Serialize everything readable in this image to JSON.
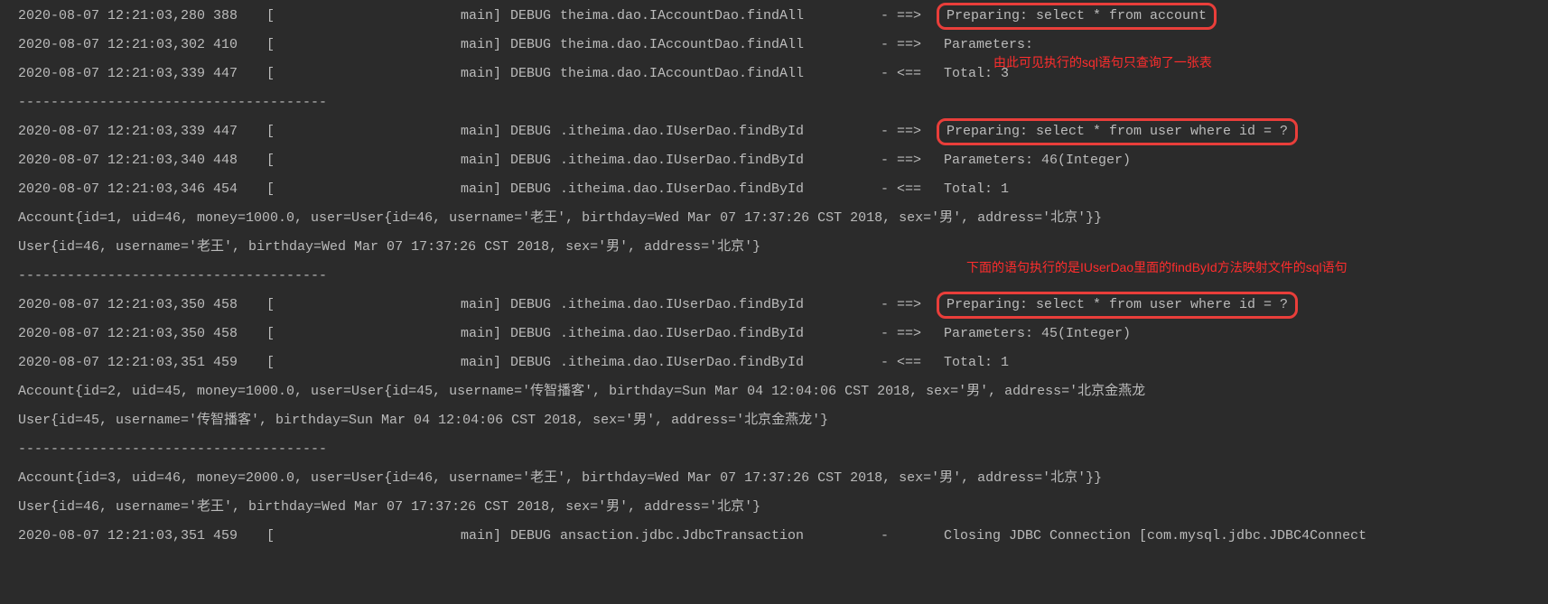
{
  "lines": [
    {
      "type": "log",
      "ts": "2020-08-07 12:21:03,280 388",
      "thread": "main]",
      "level": "DEBUG",
      "logger": "theima.dao.IAccountDao.findAll",
      "arrow": "- ==>",
      "msg": "Preparing: select * from account",
      "highlight": true
    },
    {
      "type": "log",
      "ts": "2020-08-07 12:21:03,302 410",
      "thread": "main]",
      "level": "DEBUG",
      "logger": "theima.dao.IAccountDao.findAll",
      "arrow": "- ==>",
      "msg": "Parameters:"
    },
    {
      "type": "log",
      "ts": "2020-08-07 12:21:03,339 447",
      "thread": "main]",
      "level": "DEBUG",
      "logger": "theima.dao.IAccountDao.findAll",
      "arrow": "- <==",
      "msg": "    Total: 3"
    },
    {
      "type": "sep",
      "text": "--------------------------------------"
    },
    {
      "type": "log",
      "ts": "2020-08-07 12:21:03,339 447",
      "thread": "main]",
      "level": "DEBUG",
      "logger": ".itheima.dao.IUserDao.findById",
      "arrow": "- ==>",
      "msg": " Preparing: select * from user where id = ?",
      "highlight": true
    },
    {
      "type": "log",
      "ts": "2020-08-07 12:21:03,340 448",
      "thread": "main]",
      "level": "DEBUG",
      "logger": ".itheima.dao.IUserDao.findById",
      "arrow": "- ==>",
      "msg": "Parameters: 46(Integer)"
    },
    {
      "type": "log",
      "ts": "2020-08-07 12:21:03,346 454",
      "thread": "main]",
      "level": "DEBUG",
      "logger": ".itheima.dao.IUserDao.findById",
      "arrow": "- <==",
      "msg": "    Total: 1"
    },
    {
      "type": "out",
      "text": "Account{id=1, uid=46, money=1000.0, user=User{id=46, username='老王', birthday=Wed Mar 07 17:37:26 CST 2018, sex='男', address='北京'}}"
    },
    {
      "type": "out",
      "text": "User{id=46, username='老王', birthday=Wed Mar 07 17:37:26 CST 2018, sex='男', address='北京'}"
    },
    {
      "type": "sep",
      "text": "--------------------------------------"
    },
    {
      "type": "log",
      "ts": "2020-08-07 12:21:03,350 458",
      "thread": "main]",
      "level": "DEBUG",
      "logger": ".itheima.dao.IUserDao.findById",
      "arrow": "- ==>",
      "msg": " Preparing: select * from user where id = ?",
      "highlight": true
    },
    {
      "type": "log",
      "ts": "2020-08-07 12:21:03,350 458",
      "thread": "main]",
      "level": "DEBUG",
      "logger": ".itheima.dao.IUserDao.findById",
      "arrow": "- ==>",
      "msg": "Parameters: 45(Integer)"
    },
    {
      "type": "log",
      "ts": "2020-08-07 12:21:03,351 459",
      "thread": "main]",
      "level": "DEBUG",
      "logger": ".itheima.dao.IUserDao.findById",
      "arrow": "- <==",
      "msg": "    Total: 1"
    },
    {
      "type": "out",
      "text": "Account{id=2, uid=45, money=1000.0, user=User{id=45, username='传智播客', birthday=Sun Mar 04 12:04:06 CST 2018, sex='男', address='北京金燕龙"
    },
    {
      "type": "out",
      "text": "User{id=45, username='传智播客', birthday=Sun Mar 04 12:04:06 CST 2018, sex='男', address='北京金燕龙'}"
    },
    {
      "type": "sep",
      "text": "--------------------------------------"
    },
    {
      "type": "out",
      "text": "Account{id=3, uid=46, money=2000.0, user=User{id=46, username='老王', birthday=Wed Mar 07 17:37:26 CST 2018, sex='男', address='北京'}}"
    },
    {
      "type": "out",
      "text": "User{id=46, username='老王', birthday=Wed Mar 07 17:37:26 CST 2018, sex='男', address='北京'}"
    },
    {
      "type": "log",
      "ts": "2020-08-07 12:21:03,351 459",
      "thread": "main]",
      "level": "DEBUG",
      "logger": "ansaction.jdbc.JdbcTransaction",
      "arrow": "-",
      "msg": "Closing JDBC Connection [com.mysql.jdbc.JDBC4Connect"
    }
  ],
  "annotations": {
    "a1": "由此可见执行的sql语句只查询了一张表",
    "a2": "下面的语句执行的是IUserDao里面的findById方法映射文件的sql语句"
  },
  "bracket": "["
}
